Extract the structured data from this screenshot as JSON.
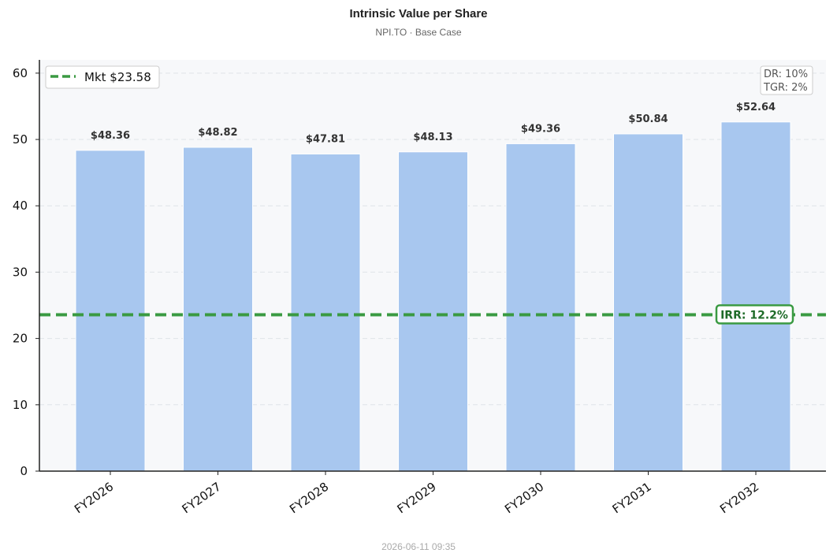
{
  "chart_data": {
    "type": "bar",
    "title": "Intrinsic Value per Share",
    "subtitle": "NPI.TO  ·  Base Case",
    "categories": [
      "FY2026",
      "FY2027",
      "FY2028",
      "FY2029",
      "FY2030",
      "FY2031",
      "FY2032"
    ],
    "values": [
      48.36,
      48.82,
      47.81,
      48.13,
      49.36,
      50.84,
      52.64
    ],
    "value_labels": [
      "$48.36",
      "$48.82",
      "$47.81",
      "$48.13",
      "$49.36",
      "$50.84",
      "$52.64"
    ],
    "ylim": [
      0,
      62
    ],
    "yticks": [
      0,
      10,
      20,
      30,
      40,
      50,
      60
    ],
    "grid": true,
    "bar_color": "#a8c7ef",
    "reference_line": {
      "value": 23.58,
      "label": "Mkt $23.58",
      "color": "#3a9a42",
      "style": "dashed"
    },
    "legend": {
      "placement": "top-left",
      "entries": [
        "Mkt $23.58"
      ]
    },
    "annotations": {
      "irr": "IRR: 12.2%",
      "assumptions": [
        "DR: 10%",
        "TGR: 2%"
      ]
    },
    "timestamp": "2026-06-11  09:35"
  }
}
